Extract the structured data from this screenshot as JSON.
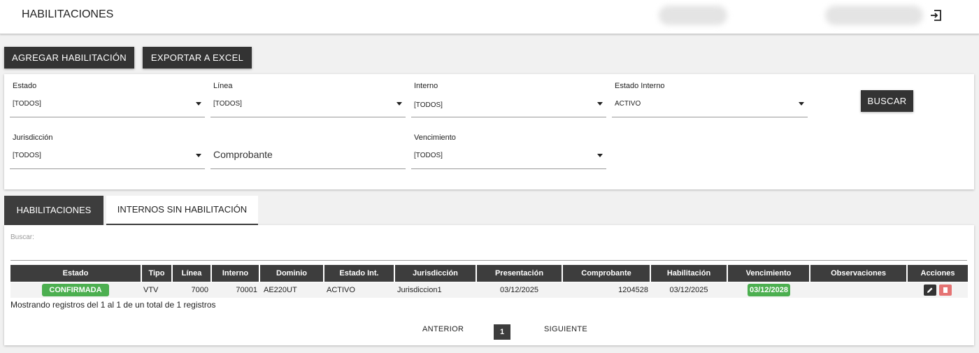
{
  "header": {
    "title": "HABILITACIONES"
  },
  "toolbar": {
    "add_label": "AGREGAR HABILITACIÓN",
    "export_label": "EXPORTAR A EXCEL"
  },
  "filters": {
    "estado": {
      "label": "Estado",
      "value": "[TODOS]"
    },
    "linea": {
      "label": "Línea",
      "value": "[TODOS]"
    },
    "interno": {
      "label": "Interno",
      "value": "[TODOS]"
    },
    "estado_interno": {
      "label": "Estado Interno",
      "value": "ACTIVO"
    },
    "jurisdiccion": {
      "label": "Jurisdicción",
      "value": "[TODOS]"
    },
    "comprobante": {
      "placeholder": "Comprobante"
    },
    "vencimiento": {
      "label": "Vencimiento",
      "value": "[TODOS]"
    },
    "search_button": "BUSCAR"
  },
  "tabs": [
    {
      "label": "HABILITACIONES"
    },
    {
      "label": "INTERNOS SIN HABILITACIÓN"
    }
  ],
  "table": {
    "search_label": "Buscar:",
    "columns": [
      "Estado",
      "Tipo",
      "Línea",
      "Interno",
      "Dominio",
      "Estado Int.",
      "Jurisdicción",
      "Presentación",
      "Comprobante",
      "Habilitación",
      "Vencimiento",
      "Observaciones",
      "Acciones"
    ],
    "rows": [
      {
        "estado": "CONFIRMADA",
        "tipo": "VTV",
        "linea": "7000",
        "interno": "70001",
        "dominio": "AE220UT",
        "estado_int": "ACTIVO",
        "jurisdiccion": "Jurisdiccion1",
        "presentacion": "03/12/2025",
        "comprobante": "1204528",
        "habilitacion": "03/12/2025",
        "vencimiento": "03/12/2028",
        "observaciones": ""
      }
    ],
    "info": "Mostrando registros del 1 al 1 de un total de 1 registros"
  },
  "pagination": {
    "prev": "ANTERIOR",
    "current": "1",
    "next": "SIGUIENTE"
  },
  "colors": {
    "dark": "#333333",
    "header_dark": "#3d3d3d",
    "badge_green": "#4caf50",
    "delete_red": "#e57373"
  }
}
